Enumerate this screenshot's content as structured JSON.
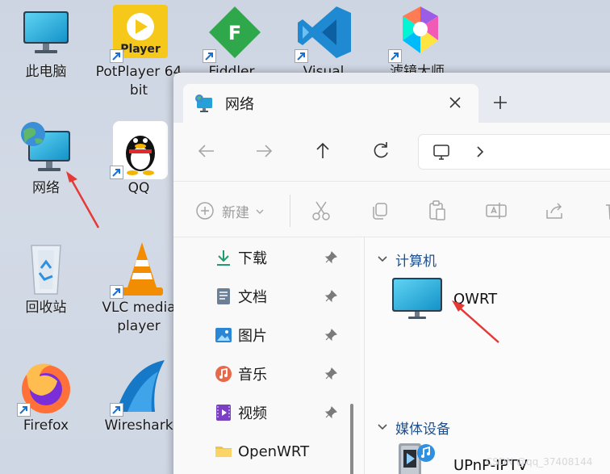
{
  "desktop": {
    "icons": [
      {
        "label": "此电脑",
        "icon": "monitor-icon"
      },
      {
        "label": "PotPlayer 64 bit",
        "icon": "potplayer-icon",
        "shortcut": true
      },
      {
        "label": "Fiddler",
        "icon": "fiddler-icon",
        "shortcut": true
      },
      {
        "label": "Visual",
        "icon": "vscode-icon",
        "shortcut": true
      },
      {
        "label": "滤镜大师",
        "icon": "colorful-app-icon",
        "shortcut": true
      },
      {
        "label": "网络",
        "icon": "network-globe-icon"
      },
      {
        "label": "QQ",
        "icon": "qq-penguin-icon",
        "shortcut": true
      },
      {
        "label": "回收站",
        "icon": "recycle-bin-icon"
      },
      {
        "label": "VLC media player",
        "icon": "vlc-cone-icon",
        "shortcut": true
      },
      {
        "label": "Firefox",
        "icon": "firefox-icon",
        "shortcut": true
      },
      {
        "label": "Wireshark",
        "icon": "wireshark-fin-icon",
        "shortcut": true
      }
    ],
    "potplayer_logo_text": "Player",
    "fiddler_logo_text": "F"
  },
  "explorer": {
    "tab_title": "网络",
    "new_label": "新建",
    "sidebar": [
      {
        "label": "下载",
        "icon": "download-icon",
        "pinned": true
      },
      {
        "label": "文档",
        "icon": "document-icon",
        "pinned": true
      },
      {
        "label": "图片",
        "icon": "pictures-icon",
        "pinned": true
      },
      {
        "label": "音乐",
        "icon": "music-icon",
        "pinned": true
      },
      {
        "label": "视频",
        "icon": "video-icon",
        "pinned": true
      },
      {
        "label": "OpenWRT",
        "icon": "folder-icon",
        "pinned": false
      }
    ],
    "groups": [
      {
        "label": "计算机",
        "items": [
          {
            "label": "QWRT",
            "icon": "computer-icon"
          }
        ]
      },
      {
        "label": "媒体设备",
        "items": [
          {
            "label": "UPnP-IPTV",
            "icon": "media-device-icon"
          }
        ]
      }
    ]
  },
  "annotations": {
    "color": "#e53935"
  },
  "watermark": "CSDN @qq_37408144"
}
